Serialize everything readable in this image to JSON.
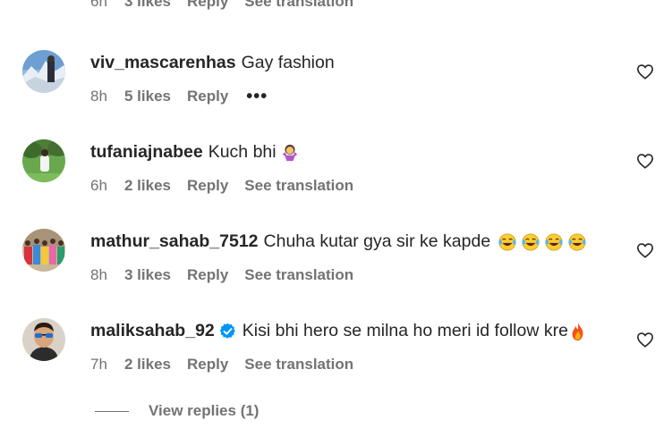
{
  "partial_top": {
    "time": "6h",
    "likes": "3 likes",
    "reply": "Reply",
    "translate": "See translation"
  },
  "comments": [
    {
      "username": "viv_mascarenhas",
      "text": "Gay fashion",
      "time": "8h",
      "likes": "5 likes",
      "reply": "Reply",
      "more": "•••",
      "avatar_icon": "mountain-photo-avatar",
      "emojis": []
    },
    {
      "username": "tufaniajnabee",
      "text": "Kuch bhi",
      "time": "6h",
      "likes": "2 likes",
      "reply": "Reply",
      "translate": "See translation",
      "avatar_icon": "park-photo-avatar",
      "emojis": [
        "person-shrugging-emoji"
      ]
    },
    {
      "username": "mathur_sahab_7512",
      "text": "Chuha kutar gya sir ke kapde",
      "time": "8h",
      "likes": "3 likes",
      "reply": "Reply",
      "translate": "See translation",
      "avatar_icon": "group-photo-avatar",
      "emojis": [
        "laughing-tears-emoji",
        "laughing-tears-emoji",
        "laughing-tears-emoji",
        "laughing-tears-emoji"
      ]
    },
    {
      "username": "maliksahab_92",
      "verified": true,
      "text": "Kisi bhi hero se milna ho meri id follow kre",
      "time": "7h",
      "likes": "2 likes",
      "reply": "Reply",
      "translate": "See translation",
      "avatar_icon": "sunglasses-man-avatar",
      "emojis": [
        "fire-emoji"
      ]
    }
  ],
  "view_replies": "View replies (1)",
  "colors": {
    "text_primary": "#262626",
    "text_secondary": "#737373",
    "verified_blue": "#0095f6",
    "background": "#ffffff"
  }
}
